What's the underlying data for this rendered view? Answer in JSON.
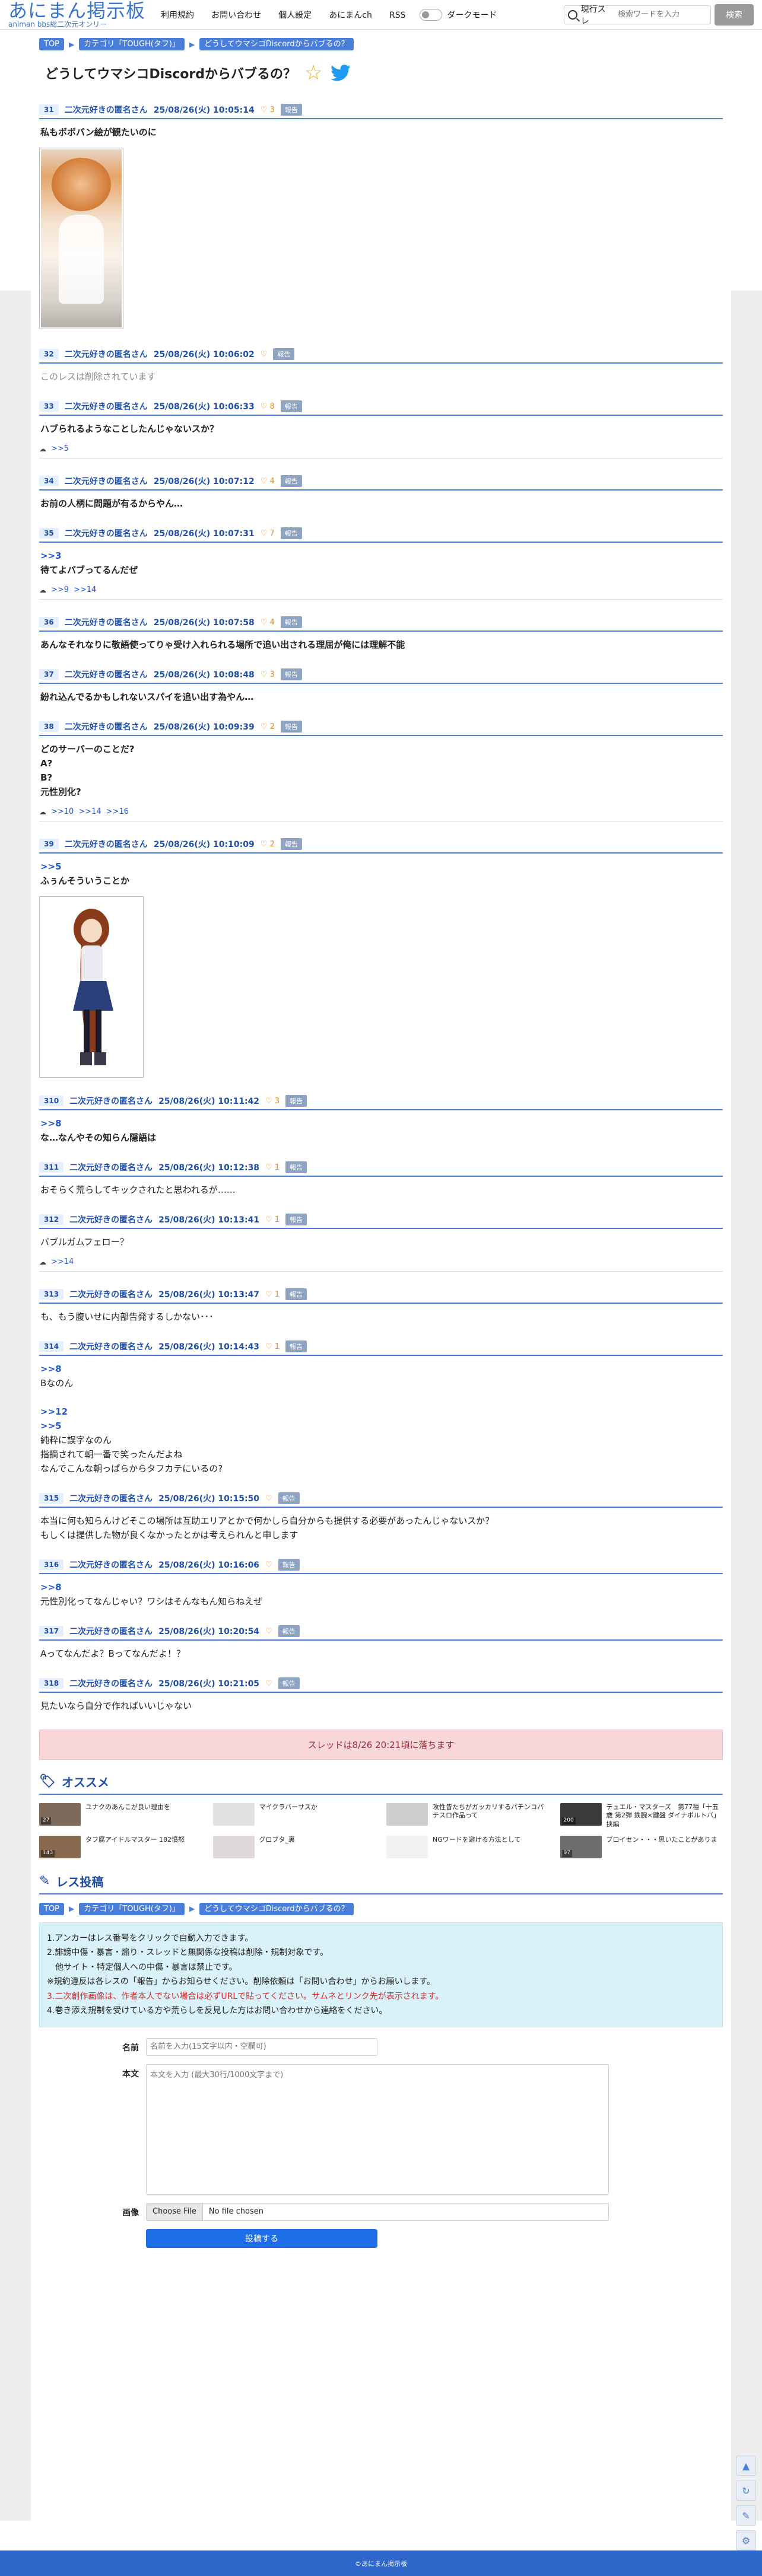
{
  "header": {
    "logo_main": "あにまん掲示板",
    "logo_sub": "animan bbs総二次元オンリー",
    "nav": [
      "利用規約",
      "お問い合わせ",
      "個人設定",
      "あにまんch",
      "RSS"
    ],
    "dark_mode_label": "ダークモード",
    "search_select": "現行スレ",
    "search_placeholder": "検索ワードを入力",
    "search_button": "検索"
  },
  "breadcrumb": [
    "TOP",
    "カテゴリ「TOUGH(タフ)」",
    "どうしてウマシコDiscordからバブるの？"
  ],
  "thread_title": "どうしてウマシコDiscordからバブるの？",
  "posts": [
    {
      "num": "31",
      "name": "二次元好きの匿名さん",
      "date": "25/08/26(火) 10:05:14",
      "likes": "3",
      "body": [
        "私もボボバン絵が観たいのに"
      ],
      "bold": true,
      "image": "img1",
      "replies": []
    },
    {
      "num": "32",
      "name": "二次元好きの匿名さん",
      "date": "25/08/26(火) 10:06:02",
      "likes": "",
      "deleted": "このレスは削除されています",
      "body": [],
      "replies": []
    },
    {
      "num": "33",
      "name": "二次元好きの匿名さん",
      "date": "25/08/26(火) 10:06:33",
      "likes": "8",
      "body": [
        "ハブられるようなことしたんじゃないスか？"
      ],
      "bold": true,
      "replies": [
        ">>5"
      ]
    },
    {
      "num": "34",
      "name": "二次元好きの匿名さん",
      "date": "25/08/26(火) 10:07:12",
      "likes": "4",
      "body": [
        "お前の人柄に問題が有るからやん…"
      ],
      "bold": true,
      "replies": []
    },
    {
      "num": "35",
      "name": "二次元好きの匿名さん",
      "date": "25/08/26(火) 10:07:31",
      "likes": "7",
      "body": [
        ">>3",
        "待てよバブってるんだぜ"
      ],
      "bold": true,
      "replies": [
        ">>9",
        ">>14"
      ]
    },
    {
      "num": "36",
      "name": "二次元好きの匿名さん",
      "date": "25/08/26(火) 10:07:58",
      "likes": "4",
      "body": [
        "あんなそれなりに敬語使ってりゃ受け入れられる場所で追い出される理屈が俺には理解不能"
      ],
      "bold": true,
      "replies": []
    },
    {
      "num": "37",
      "name": "二次元好きの匿名さん",
      "date": "25/08/26(火) 10:08:48",
      "likes": "3",
      "body": [
        "紛れ込んでるかもしれないスパイを追い出す為やん…"
      ],
      "bold": true,
      "replies": []
    },
    {
      "num": "38",
      "name": "二次元好きの匿名さん",
      "date": "25/08/26(火) 10:09:39",
      "likes": "2",
      "body": [
        "どのサーバーのことだ?",
        "A?",
        "B?",
        "元性別化?"
      ],
      "bold": true,
      "replies": [
        ">>10",
        ">>14",
        ">>16"
      ]
    },
    {
      "num": "39",
      "name": "二次元好きの匿名さん",
      "date": "25/08/26(火) 10:10:09",
      "likes": "2",
      "body": [
        ">>5",
        "ふぅんそういうことか"
      ],
      "bold": true,
      "image": "img2",
      "replies": []
    },
    {
      "num": "310",
      "name": "二次元好きの匿名さん",
      "date": "25/08/26(火) 10:11:42",
      "likes": "3",
      "body": [
        ">>8",
        "な…なんやその知らん隠語は"
      ],
      "bold": true,
      "replies": []
    },
    {
      "num": "311",
      "name": "二次元好きの匿名さん",
      "date": "25/08/26(火) 10:12:38",
      "likes": "1",
      "body": [
        "おそらく荒らしてキックされたと思われるが……"
      ],
      "bold": false,
      "replies": []
    },
    {
      "num": "312",
      "name": "二次元好きの匿名さん",
      "date": "25/08/26(火) 10:13:41",
      "likes": "1",
      "body": [
        "バブルガムフェロー？"
      ],
      "bold": false,
      "replies": [
        ">>14"
      ]
    },
    {
      "num": "313",
      "name": "二次元好きの匿名さん",
      "date": "25/08/26(火) 10:13:47",
      "likes": "1",
      "body": [
        "も、もう腹いせに内部告発するしかない･･･"
      ],
      "bold": false,
      "replies": []
    },
    {
      "num": "314",
      "name": "二次元好きの匿名さん",
      "date": "25/08/26(火) 10:14:43",
      "likes": "1",
      "body": [
        ">>8",
        "Bなのん",
        "",
        ">>12",
        ">>5",
        "純粋に誤字なのん",
        "指摘されて朝一番で笑ったんだよね",
        "なんでこんな朝っぱらからタフカテにいるの?"
      ],
      "bold": false,
      "replies": []
    },
    {
      "num": "315",
      "name": "二次元好きの匿名さん",
      "date": "25/08/26(火) 10:15:50",
      "likes": "",
      "body": [
        "本当に何も知らんけどそこの場所は互助エリアとかで何かしら自分からも提供する必要があったんじゃないスか？",
        "もしくは提供した物が良くなかったとかは考えられんと申します"
      ],
      "bold": false,
      "replies": []
    },
    {
      "num": "316",
      "name": "二次元好きの匿名さん",
      "date": "25/08/26(火) 10:16:06",
      "likes": "",
      "body": [
        ">>8",
        "元性別化ってなんじゃい？ワシはそんなもん知らねえぜ"
      ],
      "bold": false,
      "replies": []
    },
    {
      "num": "317",
      "name": "二次元好きの匿名さん",
      "date": "25/08/26(火) 10:20:54",
      "likes": "",
      "body": [
        "Aってなんだよ？Bってなんだよ！？"
      ],
      "bold": false,
      "replies": []
    },
    {
      "num": "318",
      "name": "二次元好きの匿名さん",
      "date": "25/08/26(火) 10:21:05",
      "likes": "",
      "body": [
        "見たいなら自分で作ればいいじゃない"
      ],
      "bold": false,
      "replies": []
    }
  ],
  "report_label": "報告",
  "notice": "スレッドは8/26 20:21頃に落ちます",
  "recommend": {
    "title": "オススメ",
    "items": [
      {
        "title": "ユナクのあんこが良い理由を",
        "count": "27",
        "color": "#7d6a5a"
      },
      {
        "title": "マイクラバーサスか",
        "count": "",
        "color": "#e2e2e2"
      },
      {
        "title": "攻性皆たちがガッカリするパチンコパチスロ作品って",
        "count": "",
        "color": "#cfcfcf"
      },
      {
        "title": "デュエル・マスターズ　第77種「十五歳 第2弾 鉄腕×鍵盤 ダイナボルトバ」挟編",
        "count": "200",
        "color": "#3b3b3b"
      },
      {
        "title": "タフ腐アイドルマスター 182憤怒",
        "count": "143",
        "color": "#8a6a4e"
      },
      {
        "title": "グロブタ_裏",
        "count": "",
        "color": "#e0d9d9"
      },
      {
        "title": "NGワードを避ける方法として",
        "count": "",
        "color": "#f2f2f2"
      },
      {
        "title": "ブロイセン・・・思いたことがありま",
        "count": "97",
        "color": "#6e6e6e"
      }
    ]
  },
  "reply_section": {
    "title": "レス投稿",
    "info": [
      {
        "text": "1.アンカーはレス番号をクリックで自動入力できます。",
        "red": false
      },
      {
        "text": "2.誹謗中傷・暴言・煽り・スレッドと無関係な投稿は削除・規制対象です。",
        "red": false
      },
      {
        "text": "　他サイト・特定個人への中傷・暴言は禁止です。",
        "red": false
      },
      {
        "text": "※規約違反は各レスの「報告」からお知らせください。削除依頼は「お問い合わせ」からお願いします。",
        "red": false
      },
      {
        "text": "3.二次創作画像は、作者本人でない場合は必ずURLで貼ってください。サムネとリンク先が表示されます。",
        "red": true
      },
      {
        "text": "4.巻き添え規制を受けている方や荒らしを反見した方はお問い合わせから連絡をください。",
        "red": false
      }
    ],
    "name_label": "名前",
    "name_placeholder": "名前を入力(15文字以内・空欄可)",
    "body_label": "本文",
    "body_placeholder": "本文を入力 (最大30行/1000文字まで)",
    "image_label": "画像",
    "file_button": "Choose File",
    "file_status": "No file chosen",
    "submit": "投稿する"
  },
  "footer": "©あにまん掲示板"
}
